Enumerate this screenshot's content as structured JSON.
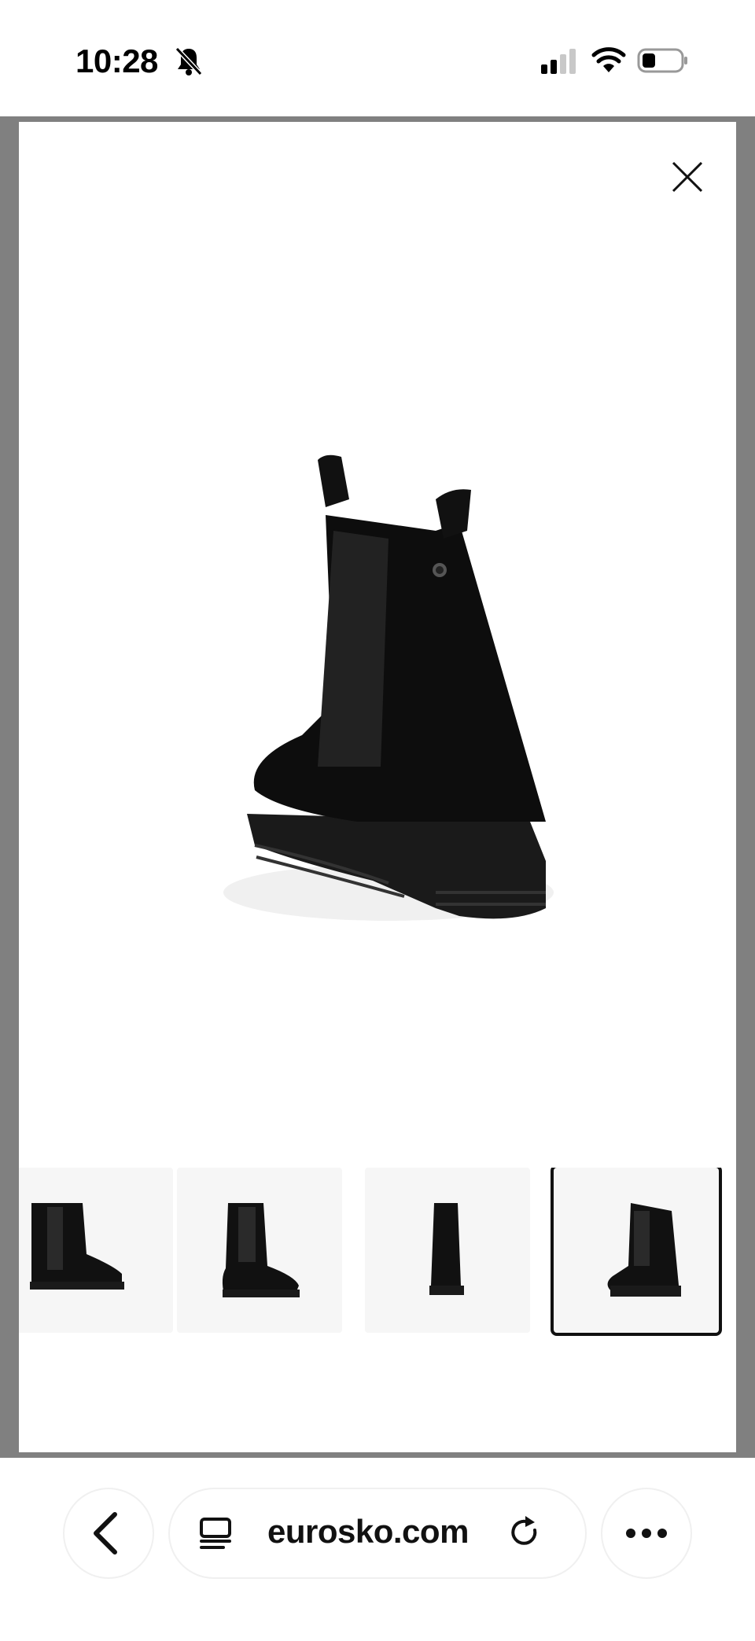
{
  "status_bar": {
    "time": "10:28",
    "icons": [
      "bell-slash-icon",
      "cellular-signal-icon",
      "wifi-icon",
      "battery-icon"
    ]
  },
  "gallery": {
    "close_icon": "close-icon",
    "main_image_alt": "black chelsea boot",
    "thumbnails_count": 4,
    "selected_index": 3
  },
  "browser": {
    "url": "eurosko.com",
    "back_icon": "chevron-left-icon",
    "tabs_icon": "tabs-icon",
    "reload_icon": "reload-icon",
    "more_icon": "more-icon"
  },
  "colors": {
    "overlay": "#808080",
    "selected_border": "#111111"
  }
}
